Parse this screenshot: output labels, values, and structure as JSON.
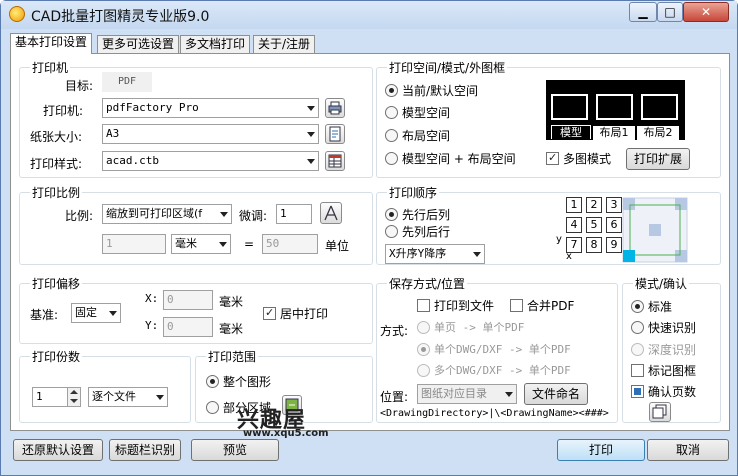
{
  "window": {
    "title": "CAD批量打图精灵专业版9.0"
  },
  "tabs": [
    "基本打印设置",
    "更多可选设置",
    "多文档打印",
    "关于/注册"
  ],
  "printer": {
    "group": "打印机",
    "target_label": "目标:",
    "target_value": "PDF",
    "printer_label": "打印机:",
    "printer_value": "pdfFactory Pro",
    "paper_label": "纸张大小:",
    "paper_value": "A3",
    "style_label": "打印样式:",
    "style_value": "acad.ctb"
  },
  "space": {
    "group": "打印空间/模式/外图框",
    "options": [
      "当前/默认空间",
      "模型空间",
      "布局空间",
      "模型空间 + 布局空间"
    ],
    "selected": 0,
    "preview_tabs": [
      "模型",
      "布局1",
      "布局2"
    ],
    "multi_mode": "多图模式",
    "expand_button": "打印扩展"
  },
  "scale": {
    "group": "打印比例",
    "ratio_label": "比例:",
    "ratio_value": "缩放到可打印区域(f",
    "fine_label": "微调:",
    "fine_value": "1",
    "num_value": "1",
    "unit_value": "毫米",
    "equals": "=",
    "den_value": "50",
    "unit_label": "单位"
  },
  "order": {
    "group": "打印顺序",
    "options": [
      "先行后列",
      "先列后行"
    ],
    "selected": 0,
    "sort_value": "X升序Y降序",
    "grid": [
      "1",
      "2",
      "3",
      "4",
      "5",
      "6",
      "7",
      "8",
      "9"
    ],
    "axis_y": "y",
    "axis_x": "x"
  },
  "offset": {
    "group": "打印偏移",
    "base_label": "基准:",
    "base_value": "固定",
    "x_label": "X:",
    "x_value": "0",
    "x_unit": "毫米",
    "y_label": "Y:",
    "y_value": "0",
    "y_unit": "毫米",
    "center": "居中打印"
  },
  "save": {
    "group": "保存方式/位置",
    "to_file": "打印到文件",
    "merge_pdf": "合并PDF",
    "mode_label": "方式:",
    "modes": [
      "单页 -> 单个PDF",
      "单个DWG/DXF -> 单个PDF",
      "多个DWG/DXF -> 单个PDF"
    ],
    "location_label": "位置:",
    "location_value": "图纸对应目录",
    "naming_button": "文件命名",
    "path_pattern": "<DrawingDirectory>|\\<DrawingName><###>"
  },
  "confirm": {
    "group": "模式/确认",
    "options": [
      "标准",
      "快速识别",
      "深度识别"
    ],
    "selected": 0,
    "mark_frame": "标记图框",
    "confirm_pages": "确认页数"
  },
  "copies": {
    "group": "打印份数",
    "value": "1",
    "mode_value": "逐个文件"
  },
  "range": {
    "group": "打印范围",
    "options": [
      "整个图形",
      "部分区域"
    ],
    "selected": 0
  },
  "bottom": {
    "restore": "还原默认设置",
    "title_recog": "标题栏识别",
    "preview": "预览",
    "print": "打印",
    "cancel": "取消"
  },
  "watermark": {
    "text": "兴趣屋",
    "url": "www.xqu5.com"
  },
  "colors": {
    "accent": "#3c7fb1",
    "selection": "#00b4e6"
  }
}
